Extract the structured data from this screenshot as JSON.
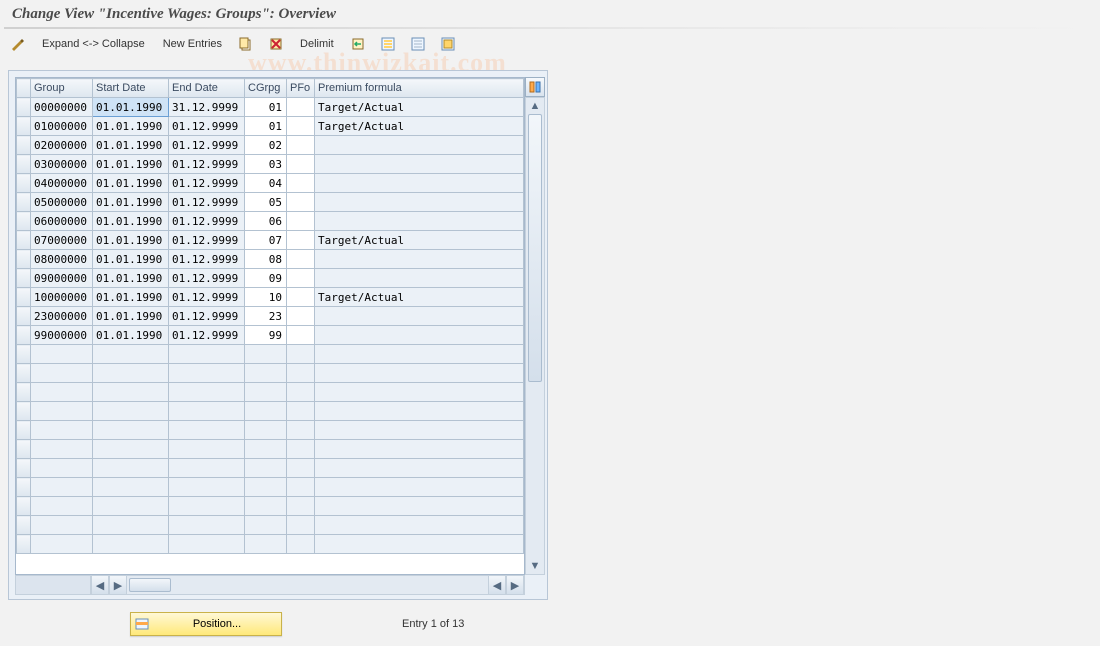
{
  "title": "Change View \"Incentive Wages: Groups\": Overview",
  "toolbar": {
    "expand_collapse": "Expand <-> Collapse",
    "new_entries": "New Entries",
    "delimit": "Delimit"
  },
  "table": {
    "columns": {
      "group": "Group",
      "start": "Start Date",
      "end": "End Date",
      "cgrpg": "CGrpg",
      "pfo": "PFo",
      "premium": "Premium formula"
    },
    "rows": [
      {
        "group": "00000000",
        "start": "01.01.1990",
        "end": "31.12.9999",
        "cgrpg": "01",
        "pfo": "",
        "premium": "Target/Actual",
        "hl": true
      },
      {
        "group": "01000000",
        "start": "01.01.1990",
        "end": "01.12.9999",
        "cgrpg": "01",
        "pfo": "",
        "premium": "Target/Actual"
      },
      {
        "group": "02000000",
        "start": "01.01.1990",
        "end": "01.12.9999",
        "cgrpg": "02",
        "pfo": "",
        "premium": ""
      },
      {
        "group": "03000000",
        "start": "01.01.1990",
        "end": "01.12.9999",
        "cgrpg": "03",
        "pfo": "",
        "premium": ""
      },
      {
        "group": "04000000",
        "start": "01.01.1990",
        "end": "01.12.9999",
        "cgrpg": "04",
        "pfo": "",
        "premium": ""
      },
      {
        "group": "05000000",
        "start": "01.01.1990",
        "end": "01.12.9999",
        "cgrpg": "05",
        "pfo": "",
        "premium": ""
      },
      {
        "group": "06000000",
        "start": "01.01.1990",
        "end": "01.12.9999",
        "cgrpg": "06",
        "pfo": "",
        "premium": ""
      },
      {
        "group": "07000000",
        "start": "01.01.1990",
        "end": "01.12.9999",
        "cgrpg": "07",
        "pfo": "",
        "premium": "Target/Actual"
      },
      {
        "group": "08000000",
        "start": "01.01.1990",
        "end": "01.12.9999",
        "cgrpg": "08",
        "pfo": "",
        "premium": ""
      },
      {
        "group": "09000000",
        "start": "01.01.1990",
        "end": "01.12.9999",
        "cgrpg": "09",
        "pfo": "",
        "premium": ""
      },
      {
        "group": "10000000",
        "start": "01.01.1990",
        "end": "01.12.9999",
        "cgrpg": "10",
        "pfo": "",
        "premium": "Target/Actual"
      },
      {
        "group": "23000000",
        "start": "01.01.1990",
        "end": "01.12.9999",
        "cgrpg": "23",
        "pfo": "",
        "premium": ""
      },
      {
        "group": "99000000",
        "start": "01.01.1990",
        "end": "01.12.9999",
        "cgrpg": "99",
        "pfo": "",
        "premium": ""
      }
    ],
    "empty_rows": 11
  },
  "footer": {
    "position": "Position...",
    "entry": "Entry 1 of 13"
  },
  "watermark": "www.thinwizkait.com"
}
